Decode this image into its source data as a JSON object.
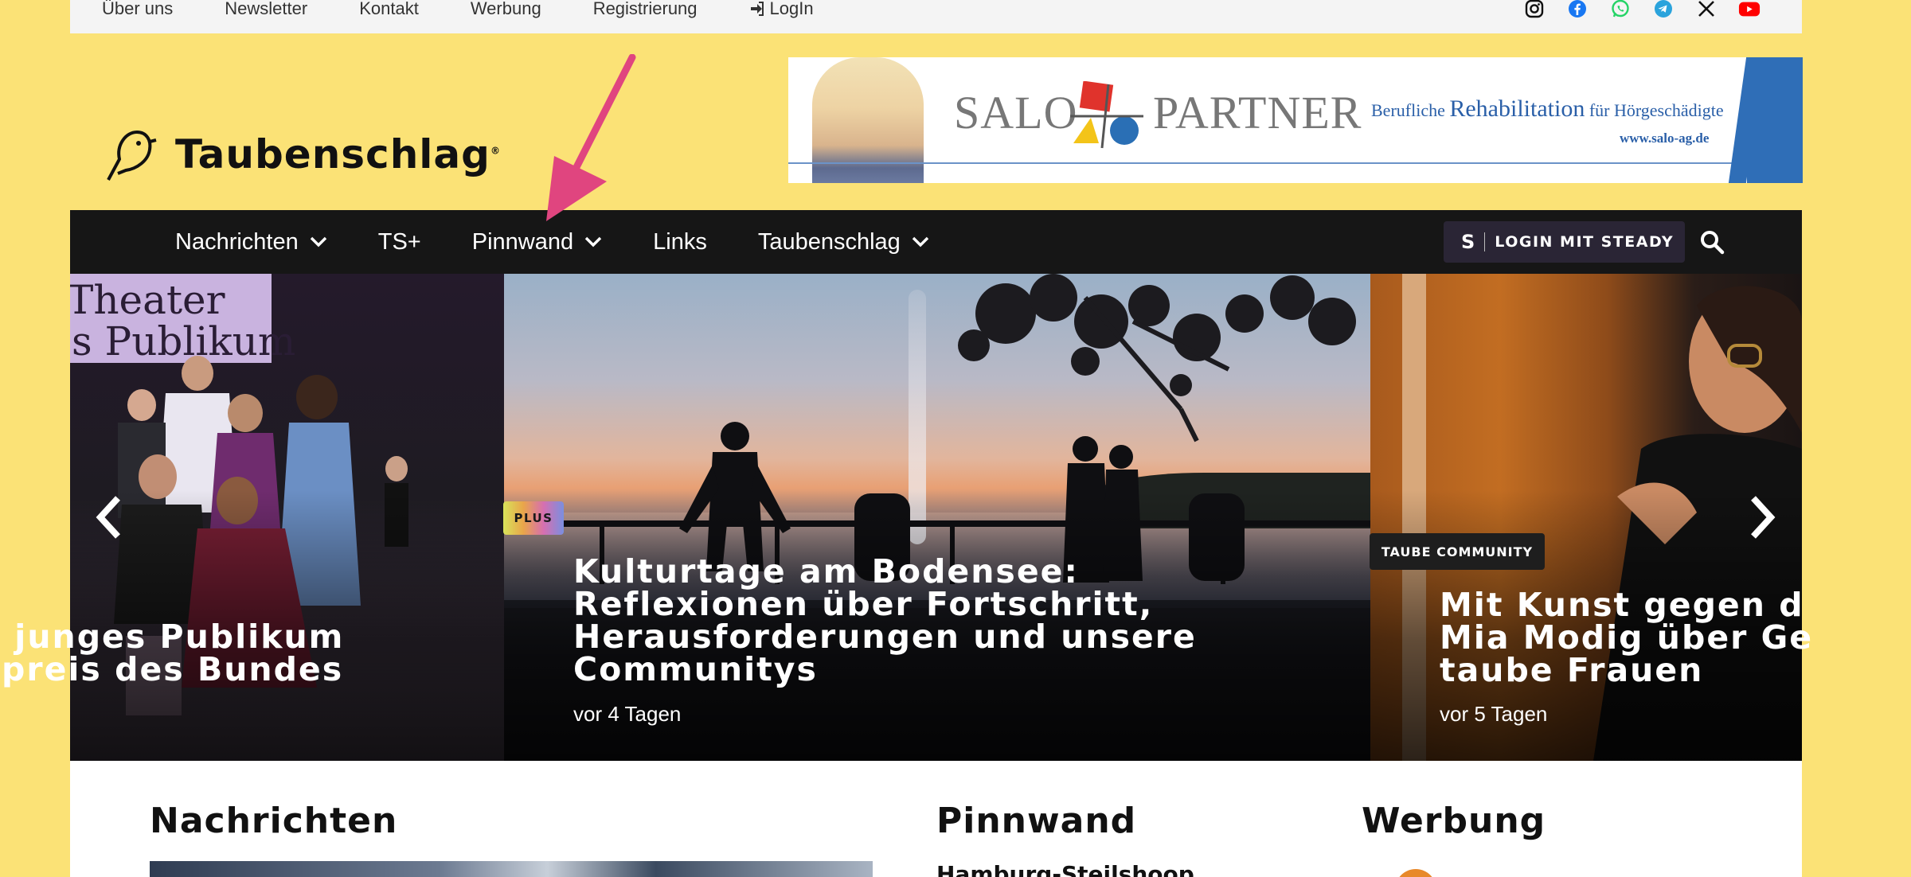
{
  "topbar": {
    "menu": [
      "Über uns",
      "Newsletter",
      "Kontakt",
      "Werbung",
      "Registrierung"
    ],
    "login": "LogIn",
    "social": [
      "instagram-icon",
      "facebook-icon",
      "whatsapp-icon",
      "telegram-icon",
      "x-icon",
      "youtube-icon"
    ]
  },
  "header": {
    "logo_text": "Taubenschlag",
    "logo_reg": "®"
  },
  "banner": {
    "brand_left": "SALO",
    "brand_right": "PARTNER",
    "tagline_prefix": "Berufliche ",
    "tagline_big": "Rehabilitation",
    "tagline_suffix": " für Hörgeschädigte",
    "url": "www.salo-ag.de"
  },
  "nav": {
    "items": [
      {
        "label": "Nachrichten",
        "dropdown": true
      },
      {
        "label": "TS+",
        "dropdown": false
      },
      {
        "label": "Pinnwand",
        "dropdown": true
      },
      {
        "label": "Links",
        "dropdown": false
      },
      {
        "label": "Taubenschlag",
        "dropdown": true
      }
    ],
    "steady_logo": "S",
    "steady_label": "LOGIN MIT STEADY"
  },
  "slider": {
    "slide1": {
      "poster_line1": "Theater",
      "poster_line2": "s Publikum",
      "title": " junges Publikum\npreis des Bundes"
    },
    "slide2": {
      "badge": "PLUS",
      "title": "Kulturtage am Bodensee:\nReflexionen über Fortschritt,\nHerausforderungen und unsere\nCommunitys",
      "meta": "vor 4 Tagen"
    },
    "slide3": {
      "badge": "TAUBE COMMUNITY",
      "title": "Mit Kunst gegen d\nMia Modig über Ge\ntaube Frauen",
      "meta": "vor 5 Tagen"
    }
  },
  "sections": {
    "news": "Nachrichten",
    "pinnwand": "Pinnwand",
    "ads": "Werbung",
    "pinnwand_first": "Hamburg-Steilshoop"
  },
  "colors": {
    "page_bg": "#fbe276",
    "nav_bg": "#161616",
    "arrow": "#e0457f"
  }
}
